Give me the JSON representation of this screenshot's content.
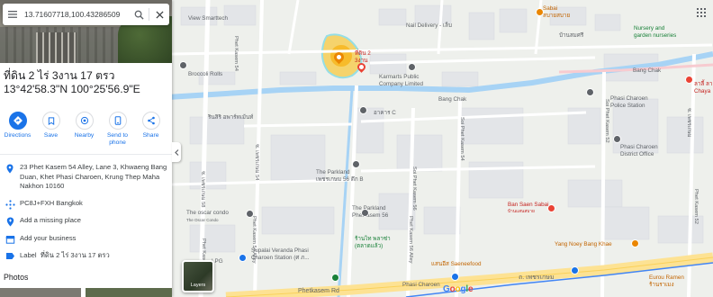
{
  "search": {
    "query": "13.71607718,100.43286509"
  },
  "place": {
    "title_line1": "ที่ดิน 2 ไร่ 3งาน 17 ตรว",
    "title_line2": "13°42'58.3\"N 100°25'56.9\"E"
  },
  "actions": [
    {
      "label": "Directions",
      "icon": "directions-icon"
    },
    {
      "label": "Save",
      "icon": "bookmark-icon"
    },
    {
      "label": "Nearby",
      "icon": "nearby-icon"
    },
    {
      "label": "Send to phone",
      "icon": "phone-icon"
    },
    {
      "label": "Share",
      "icon": "share-icon"
    }
  ],
  "info": {
    "address": "23 Phet Kasem 54 Alley, Lane 3, Khwaeng Bang Duan, Khet Phasi Charoen, Krung Thep Maha Nakhon 10160",
    "plus_code": "PC8J+FXH Bangkok",
    "add_place": "Add a missing place",
    "add_business": "Add your business",
    "label_prefix": "Label",
    "label_value": "ที่ดิน 2 ไร่ 3งาน 17 ตรว"
  },
  "photos_title": "Photos",
  "map": {
    "layers_label": "Layers",
    "labels": {
      "view_smarttech": "View Smarttech",
      "nail_delivery": "Nail Delivery - เล็บ",
      "ban_somsri": "บ้านสมศรี",
      "sabai": "Sabai",
      "sabai_th": "สบายสบาย",
      "nursery": "Nursery and",
      "nursery2": "garden nurseries",
      "broccoli": "Broccoli Rolls",
      "pin_name1": "ที่ดิน 2",
      "pin_name2": "3งาน",
      "karmarts1": "Karmarts Public",
      "karmarts2": "Company Limited",
      "bang_chak1": "Bang Chak",
      "bang_chak2": "Bang Chak",
      "la_lee1": "ลาลี้ ลา",
      "la_lee2": "Chaya",
      "rinsi": "รินสิริ อพาร์ทเม้นท์",
      "arkhan_c": "อาคาร C",
      "phasi_police1": "Phasi Charoen",
      "phasi_police2": "Police Station",
      "phasi_office1": "Phasi Charoen",
      "phasi_office2": "District Office",
      "parkland1_1": "The Parkland",
      "parkland1_2": "เพชรเกษม 56 ตึก B",
      "parkland2_1": "The Parkland",
      "parkland2_2": "Phetkasem 56",
      "oscar1": "The oscar condo",
      "oscar2": "The Oscar Condo",
      "ban_saen1": "Ban Saen Sabai",
      "ban_saen2": "บ้านแสนสบาย",
      "supalai1": "Supalai Veranda Phasi",
      "supalai2": "Charoen Station (ศ ภ...",
      "lpg": "LPG",
      "seafood1": "ร้านไท พลาซ่า",
      "seafood2": "(ตลาดแล้ว)",
      "saeneefood": "แสนอีส Saeneefood",
      "yang_noey": "Yang Noey Bang Khae",
      "phasi_charoen_stn": "Phasi Charoen",
      "phetkasem_rd": "Phetkasem Rd",
      "phetkasem_th": "ถ. เพชรเกษม",
      "eurou": "Eurou Ramen",
      "thai_bottom": "ร้านราเมง",
      "soi_52": "Soi Phet Kasem 52",
      "soi_56": "Soi Phet Kasem 56",
      "soi_54": "Soi Phet Kasem 54",
      "soi_alley": "Phet Kasem 56 Alley",
      "soi_58": "Phet Kasem 58 Alley",
      "soi_52_road": "Phet Kasem 52",
      "soi_th1": "ซ. เพชรเกษม 54",
      "soi_th2": "ซ. เพชรเกษม 58",
      "soi_left": "Phet Kasem 54 Alley",
      "soi_th3": "ซ. เพชรเกษม",
      "phet_kasem_54": "Phet Kasem 54",
      "alley_label": "Phet Kasem 56 Alley"
    }
  }
}
